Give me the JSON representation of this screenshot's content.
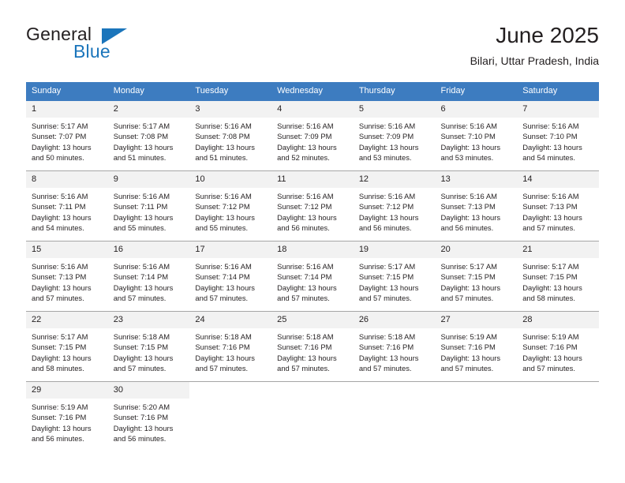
{
  "brand": {
    "word1": "General",
    "word2": "Blue",
    "logo_icon": "triangle-icon",
    "accent_color": "#1b75bb"
  },
  "header": {
    "title": "June 2025",
    "subtitle": "Bilari, Uttar Pradesh, India",
    "header_bg_color": "#3d7cc0",
    "daynum_bg_color": "#f2f2f2"
  },
  "weekdays": [
    "Sunday",
    "Monday",
    "Tuesday",
    "Wednesday",
    "Thursday",
    "Friday",
    "Saturday"
  ],
  "labels": {
    "sunrise_prefix": "Sunrise:",
    "sunset_prefix": "Sunset:",
    "daylight_prefix": "Daylight:"
  },
  "weeks": [
    [
      {
        "day": "1",
        "sunrise": "Sunrise: 5:17 AM",
        "sunset": "Sunset: 7:07 PM",
        "daylight1": "Daylight: 13 hours",
        "daylight2": "and 50 minutes."
      },
      {
        "day": "2",
        "sunrise": "Sunrise: 5:17 AM",
        "sunset": "Sunset: 7:08 PM",
        "daylight1": "Daylight: 13 hours",
        "daylight2": "and 51 minutes."
      },
      {
        "day": "3",
        "sunrise": "Sunrise: 5:16 AM",
        "sunset": "Sunset: 7:08 PM",
        "daylight1": "Daylight: 13 hours",
        "daylight2": "and 51 minutes."
      },
      {
        "day": "4",
        "sunrise": "Sunrise: 5:16 AM",
        "sunset": "Sunset: 7:09 PM",
        "daylight1": "Daylight: 13 hours",
        "daylight2": "and 52 minutes."
      },
      {
        "day": "5",
        "sunrise": "Sunrise: 5:16 AM",
        "sunset": "Sunset: 7:09 PM",
        "daylight1": "Daylight: 13 hours",
        "daylight2": "and 53 minutes."
      },
      {
        "day": "6",
        "sunrise": "Sunrise: 5:16 AM",
        "sunset": "Sunset: 7:10 PM",
        "daylight1": "Daylight: 13 hours",
        "daylight2": "and 53 minutes."
      },
      {
        "day": "7",
        "sunrise": "Sunrise: 5:16 AM",
        "sunset": "Sunset: 7:10 PM",
        "daylight1": "Daylight: 13 hours",
        "daylight2": "and 54 minutes."
      }
    ],
    [
      {
        "day": "8",
        "sunrise": "Sunrise: 5:16 AM",
        "sunset": "Sunset: 7:11 PM",
        "daylight1": "Daylight: 13 hours",
        "daylight2": "and 54 minutes."
      },
      {
        "day": "9",
        "sunrise": "Sunrise: 5:16 AM",
        "sunset": "Sunset: 7:11 PM",
        "daylight1": "Daylight: 13 hours",
        "daylight2": "and 55 minutes."
      },
      {
        "day": "10",
        "sunrise": "Sunrise: 5:16 AM",
        "sunset": "Sunset: 7:12 PM",
        "daylight1": "Daylight: 13 hours",
        "daylight2": "and 55 minutes."
      },
      {
        "day": "11",
        "sunrise": "Sunrise: 5:16 AM",
        "sunset": "Sunset: 7:12 PM",
        "daylight1": "Daylight: 13 hours",
        "daylight2": "and 56 minutes."
      },
      {
        "day": "12",
        "sunrise": "Sunrise: 5:16 AM",
        "sunset": "Sunset: 7:12 PM",
        "daylight1": "Daylight: 13 hours",
        "daylight2": "and 56 minutes."
      },
      {
        "day": "13",
        "sunrise": "Sunrise: 5:16 AM",
        "sunset": "Sunset: 7:13 PM",
        "daylight1": "Daylight: 13 hours",
        "daylight2": "and 56 minutes."
      },
      {
        "day": "14",
        "sunrise": "Sunrise: 5:16 AM",
        "sunset": "Sunset: 7:13 PM",
        "daylight1": "Daylight: 13 hours",
        "daylight2": "and 57 minutes."
      }
    ],
    [
      {
        "day": "15",
        "sunrise": "Sunrise: 5:16 AM",
        "sunset": "Sunset: 7:13 PM",
        "daylight1": "Daylight: 13 hours",
        "daylight2": "and 57 minutes."
      },
      {
        "day": "16",
        "sunrise": "Sunrise: 5:16 AM",
        "sunset": "Sunset: 7:14 PM",
        "daylight1": "Daylight: 13 hours",
        "daylight2": "and 57 minutes."
      },
      {
        "day": "17",
        "sunrise": "Sunrise: 5:16 AM",
        "sunset": "Sunset: 7:14 PM",
        "daylight1": "Daylight: 13 hours",
        "daylight2": "and 57 minutes."
      },
      {
        "day": "18",
        "sunrise": "Sunrise: 5:16 AM",
        "sunset": "Sunset: 7:14 PM",
        "daylight1": "Daylight: 13 hours",
        "daylight2": "and 57 minutes."
      },
      {
        "day": "19",
        "sunrise": "Sunrise: 5:17 AM",
        "sunset": "Sunset: 7:15 PM",
        "daylight1": "Daylight: 13 hours",
        "daylight2": "and 57 minutes."
      },
      {
        "day": "20",
        "sunrise": "Sunrise: 5:17 AM",
        "sunset": "Sunset: 7:15 PM",
        "daylight1": "Daylight: 13 hours",
        "daylight2": "and 57 minutes."
      },
      {
        "day": "21",
        "sunrise": "Sunrise: 5:17 AM",
        "sunset": "Sunset: 7:15 PM",
        "daylight1": "Daylight: 13 hours",
        "daylight2": "and 58 minutes."
      }
    ],
    [
      {
        "day": "22",
        "sunrise": "Sunrise: 5:17 AM",
        "sunset": "Sunset: 7:15 PM",
        "daylight1": "Daylight: 13 hours",
        "daylight2": "and 58 minutes."
      },
      {
        "day": "23",
        "sunrise": "Sunrise: 5:18 AM",
        "sunset": "Sunset: 7:15 PM",
        "daylight1": "Daylight: 13 hours",
        "daylight2": "and 57 minutes."
      },
      {
        "day": "24",
        "sunrise": "Sunrise: 5:18 AM",
        "sunset": "Sunset: 7:16 PM",
        "daylight1": "Daylight: 13 hours",
        "daylight2": "and 57 minutes."
      },
      {
        "day": "25",
        "sunrise": "Sunrise: 5:18 AM",
        "sunset": "Sunset: 7:16 PM",
        "daylight1": "Daylight: 13 hours",
        "daylight2": "and 57 minutes."
      },
      {
        "day": "26",
        "sunrise": "Sunrise: 5:18 AM",
        "sunset": "Sunset: 7:16 PM",
        "daylight1": "Daylight: 13 hours",
        "daylight2": "and 57 minutes."
      },
      {
        "day": "27",
        "sunrise": "Sunrise: 5:19 AM",
        "sunset": "Sunset: 7:16 PM",
        "daylight1": "Daylight: 13 hours",
        "daylight2": "and 57 minutes."
      },
      {
        "day": "28",
        "sunrise": "Sunrise: 5:19 AM",
        "sunset": "Sunset: 7:16 PM",
        "daylight1": "Daylight: 13 hours",
        "daylight2": "and 57 minutes."
      }
    ],
    [
      {
        "day": "29",
        "sunrise": "Sunrise: 5:19 AM",
        "sunset": "Sunset: 7:16 PM",
        "daylight1": "Daylight: 13 hours",
        "daylight2": "and 56 minutes."
      },
      {
        "day": "30",
        "sunrise": "Sunrise: 5:20 AM",
        "sunset": "Sunset: 7:16 PM",
        "daylight1": "Daylight: 13 hours",
        "daylight2": "and 56 minutes."
      },
      {
        "day": "",
        "sunrise": "",
        "sunset": "",
        "daylight1": "",
        "daylight2": ""
      },
      {
        "day": "",
        "sunrise": "",
        "sunset": "",
        "daylight1": "",
        "daylight2": ""
      },
      {
        "day": "",
        "sunrise": "",
        "sunset": "",
        "daylight1": "",
        "daylight2": ""
      },
      {
        "day": "",
        "sunrise": "",
        "sunset": "",
        "daylight1": "",
        "daylight2": ""
      },
      {
        "day": "",
        "sunrise": "",
        "sunset": "",
        "daylight1": "",
        "daylight2": ""
      }
    ]
  ]
}
